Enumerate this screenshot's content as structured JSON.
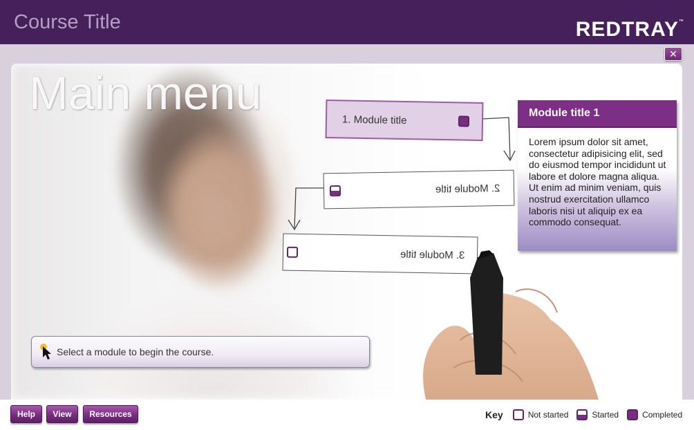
{
  "header": {
    "course_title": "Course Title",
    "logo_text": "REDTRAY",
    "logo_tm": "™"
  },
  "close_button": {
    "label": "✕",
    "icon": "close-icon"
  },
  "main": {
    "heading": "Main menu",
    "modules": [
      {
        "label": "1. Module title",
        "status": "completed",
        "selected": true
      },
      {
        "label": "2. Module title",
        "status": "started",
        "mirrored": true
      },
      {
        "label": "3. Module title",
        "status": "not-started",
        "mirrored": true
      }
    ],
    "info_card": {
      "title": "Module title 1",
      "body": "Lorem ipsum dolor sit amet, consectetur adipisicing elit, sed do eiusmod tempor incididunt ut labore et dolore magna aliqua. Ut enim ad minim veniam, quis nostrud exercitation ullamco laboris nisi ut aliquip ex ea commodo consequat."
    },
    "instruction": "Select a module to begin the course."
  },
  "footer": {
    "buttons": {
      "help": "Help",
      "view": "View",
      "resources": "Resources"
    },
    "key": {
      "title": "Key",
      "not_started": "Not started",
      "started": "Started",
      "completed": "Completed"
    }
  },
  "colors": {
    "header_bg": "#45205a",
    "accent": "#7a2c80",
    "page_bg": "#d9d0dd"
  }
}
